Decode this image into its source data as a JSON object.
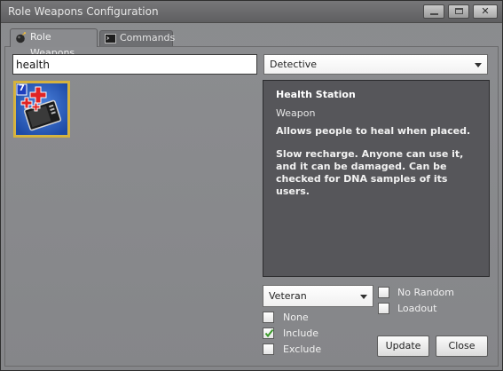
{
  "window": {
    "title": "Role Weapons Configuration",
    "controls": {
      "minimize": "minimize",
      "maximize": "maximize",
      "close": "✕"
    }
  },
  "tabs": [
    {
      "label": "Role Weapons",
      "icon": "bomb-icon",
      "active": true
    },
    {
      "label": "Commands",
      "icon": "terminal-icon",
      "active": false
    }
  ],
  "search": {
    "value": "health",
    "placeholder": ""
  },
  "role_select": {
    "selected": "Detective"
  },
  "weapons": [
    {
      "name": "Health Station",
      "badge": "7",
      "icon": "health-station-icon",
      "selected": true
    }
  ],
  "info": {
    "title": "Health Station",
    "type": "Weapon",
    "description": "Allows people to heal when placed.",
    "details": "Slow recharge. Anyone can use it, and it can be damaged. Can be checked for DNA samples of its users."
  },
  "rank_select": {
    "selected": "Veteran"
  },
  "options": {
    "no_random": {
      "label": "No Random",
      "checked": false
    },
    "loadout": {
      "label": "Loadout",
      "checked": false
    },
    "none": {
      "label": "None",
      "checked": false
    },
    "include": {
      "label": "Include",
      "checked": true
    },
    "exclude": {
      "label": "Exclude",
      "checked": false
    }
  },
  "buttons": {
    "update": "Update",
    "close": "Close"
  },
  "colors": {
    "panel_bg": "#56565a",
    "selection_border": "#d6b23a",
    "check_green": "#3a9a2a",
    "badge_blue": "#1f3fbf"
  }
}
